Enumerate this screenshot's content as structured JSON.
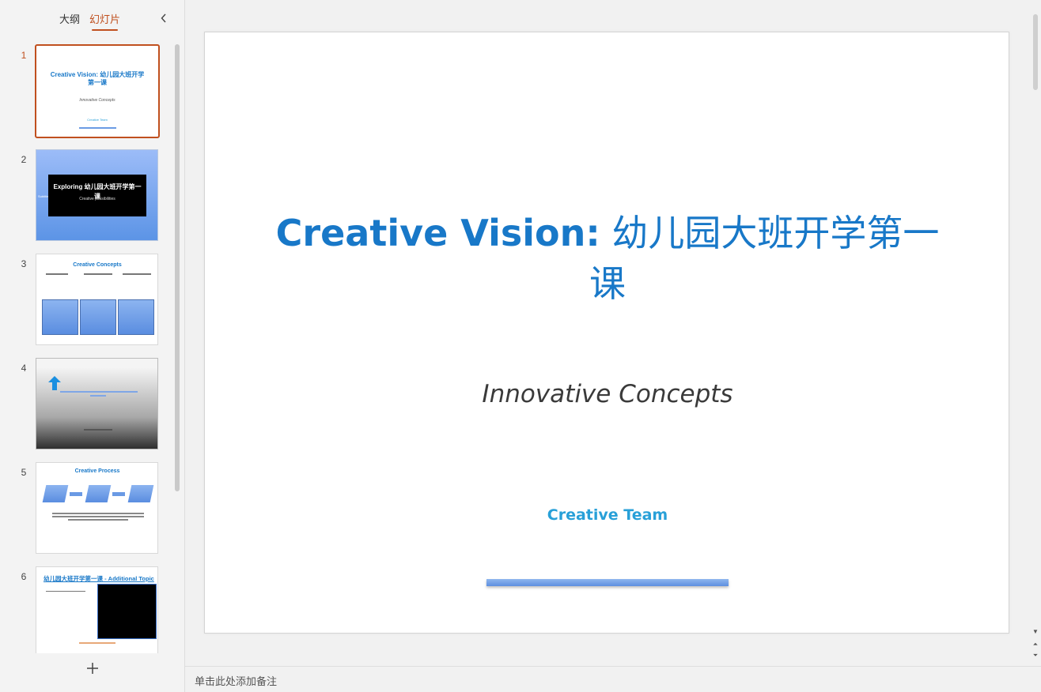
{
  "panel": {
    "tab_outline": "大纲",
    "tab_slides": "幻灯片"
  },
  "thumbnails": [
    {
      "number": "1",
      "title": "Creative Vision: 幼儿园大班开学第一课",
      "subtitle": "Innovative Concepts",
      "footer": "Creative Team"
    },
    {
      "number": "2",
      "title": "Exploring 幼儿园大班开学第一课",
      "subtitle": "Creative possibilities",
      "side_text": "Subtitle"
    },
    {
      "number": "3",
      "title": "Creative Concepts"
    },
    {
      "number": "4"
    },
    {
      "number": "5",
      "title": "Creative Process"
    },
    {
      "number": "6",
      "title": "幼儿园大班开学第一课 - Additional Topic"
    }
  ],
  "slide": {
    "title_en": "Creative Vision:",
    "title_zh": " 幼儿园大班开学第一课",
    "subtitle": "Innovative Concepts",
    "team": "Creative Team"
  },
  "notes": {
    "placeholder": "单击此处添加备注"
  },
  "colors": {
    "accent": "#c0501f",
    "title_blue": "#1878c8",
    "team_blue": "#28a0d8"
  }
}
